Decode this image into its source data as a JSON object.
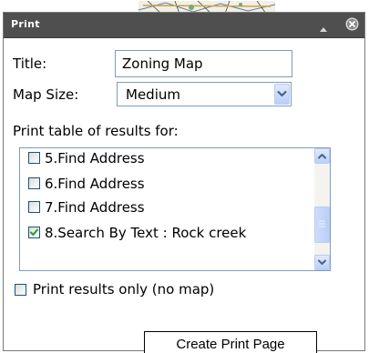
{
  "dialog": {
    "title": "Print",
    "collapse_icon": "collapse-up-icon",
    "close_icon": "close-circle-icon"
  },
  "form": {
    "title_label": "Title:",
    "title_value": "Zoning Map",
    "map_size_label": "Map Size:",
    "map_size_value": "Medium",
    "results_label": "Print table of results for:",
    "results_items": [
      {
        "label": "5.Find Address",
        "checked": false
      },
      {
        "label": "6.Find Address",
        "checked": false
      },
      {
        "label": "7.Find Address",
        "checked": false
      },
      {
        "label": "8.Search By Text : Rock creek",
        "checked": true
      }
    ],
    "results_only_label": "Print results only (no map)",
    "results_only_checked": false,
    "create_button_label": "Create Print Page"
  },
  "colors": {
    "titlebar_bg": "#4f4f4f",
    "input_border": "#7f9db9",
    "check_mark": "#21a121",
    "scrollbar_button": "#b9cff7"
  }
}
